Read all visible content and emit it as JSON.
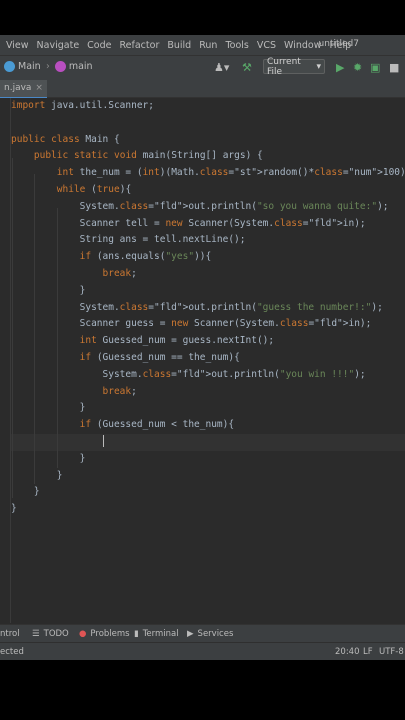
{
  "menu": [
    "View",
    "Navigate",
    "Code",
    "Refactor",
    "Build",
    "Run",
    "Tools",
    "VCS",
    "Window",
    "Help"
  ],
  "window_title": "untitled7",
  "nav": {
    "crumb1": "Main",
    "crumb2": "main",
    "run_config": "Current File"
  },
  "tab": {
    "name": "n.java"
  },
  "code_lines": [
    "import java.util.Scanner;",
    "",
    "public class Main {",
    "    public static void main(String[] args) {",
    "        int the_num = (int)(Math.random()*100);",
    "        while (true){",
    "            System.out.println(\"so you wanna quite:\");",
    "            Scanner tell = new Scanner(System.in);",
    "            String ans = tell.nextLine();",
    "            if (ans.equals(\"yes\")){",
    "                break;",
    "            }",
    "            System.out.println(\"guess the number!:\");",
    "            Scanner guess = new Scanner(System.in);",
    "            int Guessed_num = guess.nextInt();",
    "            if (Guessed_num == the_num){",
    "                System.out.println(\"you win !!!\");",
    "                break;",
    "            }",
    "            if (Guessed_num < the_num){",
    "                ",
    "            }",
    "        }",
    "    }",
    "}"
  ],
  "toolwindows": {
    "control": "ntrol",
    "todo": "TODO",
    "problems": "Problems",
    "terminal": "Terminal",
    "services": "Services"
  },
  "status": {
    "message": "ected",
    "position": "20:40",
    "line_sep": "LF",
    "encoding": "UTF-8"
  },
  "colors": {
    "keyword": "#cc7832",
    "string": "#6a8759",
    "field": "#9876aa",
    "number": "#6897bb",
    "text": "#a9b7c6",
    "background": "#2b2b2b"
  },
  "icons": [
    "user-icon",
    "build-hammer-icon",
    "run-icon",
    "debug-icon",
    "coverage-icon"
  ]
}
